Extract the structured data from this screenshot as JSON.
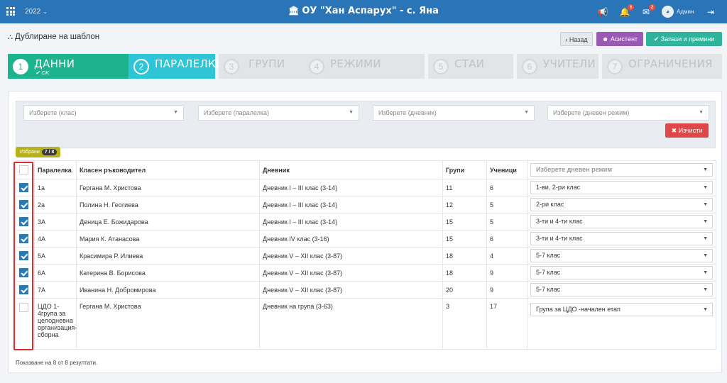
{
  "topbar": {
    "year": "2022",
    "school": "ОУ \"Хан Аспарух\" - с. Яна",
    "badge_bell": "6",
    "badge_mail": "2",
    "user": "Админ"
  },
  "page": {
    "title": "Дублиране на шаблон",
    "back_label": "Назад",
    "assistant_label": "Асистент",
    "save_label": "Запази и премини"
  },
  "wizard": [
    {
      "num": "1",
      "label": "ДАННИ",
      "sub": "✔ OK"
    },
    {
      "num": "2",
      "label": "ПАРАЛЕЛКИ"
    },
    {
      "num": "3",
      "label": "ГРУПИ"
    },
    {
      "num": "4",
      "label": "РЕЖИМИ"
    },
    {
      "num": "5",
      "label": "СТАИ"
    },
    {
      "num": "6",
      "label": "УЧИТЕЛИ"
    },
    {
      "num": "7",
      "label": "ОГРАНИЧЕНИЯ"
    }
  ],
  "filters": {
    "class": "Изберете (клас)",
    "paralelka": "Изберете (паралелка)",
    "dnevnik": "Изберете (дневник)",
    "rezhim": "Изберете (дневен режим)",
    "clear_label": "Изчисти"
  },
  "chosen": {
    "label": "Избрани",
    "count": "7 / 8"
  },
  "table": {
    "headers": {
      "paralelka": "Паралелка",
      "rakovoditel": "Класен ръководител",
      "dnevnik": "Дневник",
      "grupi": "Групи",
      "uchenici": "Ученици",
      "rezhim_placeholder": "Изберете дневен режим"
    },
    "rows": [
      {
        "paralelka": "1а",
        "rakovoditel": "Гергана М. Христова",
        "dnevnik": "Дневник I – III клас (3-14)",
        "grupi": "11",
        "uchenici": "6",
        "rezhim": "1-ви, 2-ри клас",
        "checked": true
      },
      {
        "paralelka": "2а",
        "rakovoditel": "Полина Н. Геогиева",
        "dnevnik": "Дневник I – III клас (3-14)",
        "grupi": "12",
        "uchenici": "5",
        "rezhim": "2-ри клас",
        "checked": true
      },
      {
        "paralelka": "3А",
        "rakovoditel": "Деница Е. Божидарова",
        "dnevnik": "Дневник I – III клас (3-14)",
        "grupi": "15",
        "uchenici": "5",
        "rezhim": "3-ти и 4-ти клас",
        "checked": true
      },
      {
        "paralelka": "4А",
        "rakovoditel": "Мария К. Атанасова",
        "dnevnik": "Дневник IV клас (3-16)",
        "grupi": "15",
        "uchenici": "6",
        "rezhim": "3-ти и 4-ти клас",
        "checked": true
      },
      {
        "paralelka": "5А",
        "rakovoditel": "Красимира Р. Илиева",
        "dnevnik": "Дневник V – XII клас (3-87)",
        "grupi": "18",
        "uchenici": "4",
        "rezhim": "5-7 клас",
        "checked": true
      },
      {
        "paralelka": "6А",
        "rakovoditel": "Катерина В. Борисова",
        "dnevnik": "Дневник V – XII клас (3-87)",
        "grupi": "18",
        "uchenici": "9",
        "rezhim": "5-7 клас",
        "checked": true
      },
      {
        "paralelka": "7А",
        "rakovoditel": "Иванина Н. Добромирова",
        "dnevnik": "Дневник V – XII клас (3-87)",
        "grupi": "20",
        "uchenici": "9",
        "rezhim": "5-7 клас",
        "checked": true
      },
      {
        "paralelka": "ЦДО 1-4група за целодневна организация-сборна",
        "rakovoditel": "Гергана М. Христова",
        "dnevnik": "Дневник на група (3-63)",
        "grupi": "3",
        "uchenici": "17",
        "rezhim": "Група за ЦДО -начален етап",
        "checked": false
      }
    ]
  },
  "footer": "Показване на 8 от 8 резултати.",
  "colors": {
    "topbar": "#2a74b8",
    "done": "#1cb38e",
    "active": "#2ec6d6",
    "clear": "#e04748",
    "assistant": "#9b59b6",
    "save": "#2fb39b",
    "highlight": "#e02a2a"
  }
}
